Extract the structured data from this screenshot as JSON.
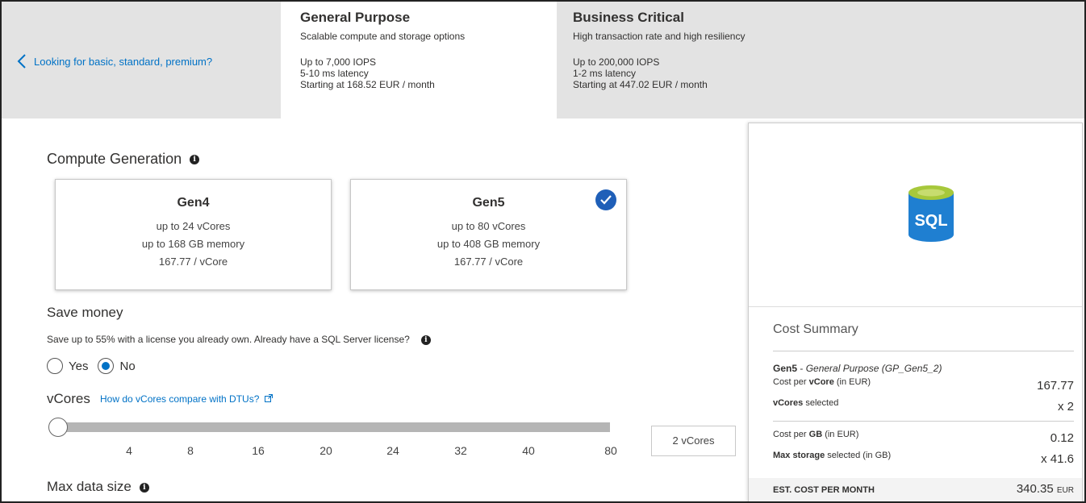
{
  "back_link": {
    "label": "Looking for basic, standard, premium?"
  },
  "tiers": {
    "general": {
      "title": "General Purpose",
      "subtitle": "Scalable compute and storage options",
      "iops": "Up to 7,000 IOPS",
      "latency": "5-10 ms latency",
      "price": "Starting at 168.52 EUR / month"
    },
    "business": {
      "title": "Business Critical",
      "subtitle": "High transaction rate and high resiliency",
      "iops": "Up to 200,000 IOPS",
      "latency": "1-2 ms latency",
      "price": "Starting at 447.02 EUR / month"
    }
  },
  "compute": {
    "title": "Compute Generation",
    "gen4": {
      "name": "Gen4",
      "vcores": "up to 24 vCores",
      "memory": "up to 168 GB memory",
      "price": "167.77 / vCore"
    },
    "gen5": {
      "name": "Gen5",
      "vcores": "up to 80 vCores",
      "memory": "up to 408 GB memory",
      "price": "167.77 / vCore",
      "selected": true
    }
  },
  "save_money": {
    "title": "Save money",
    "text": "Save up to 55% with a license you already own. Already have a SQL Server license?",
    "yes_label": "Yes",
    "no_label": "No",
    "selected": "No"
  },
  "vcores": {
    "label": "vCores",
    "link": "How do vCores compare with DTUs?",
    "ticks": [
      "4",
      "8",
      "16",
      "20",
      "24",
      "32",
      "40",
      "80"
    ],
    "value_box": "2 vCores",
    "slider_value": 2
  },
  "max_data_size": {
    "title": "Max data size"
  },
  "summary": {
    "title": "Cost Summary",
    "tier_name": "Gen5",
    "tier_detail": "General Purpose (GP_Gen5_2)",
    "cost_per_vcore_label_pre": "Cost per ",
    "cost_per_vcore_label_bold": "vCore",
    "cost_per_vcore_label_post": " (in EUR)",
    "cost_per_vcore_value": "167.77",
    "vcores_selected_label_bold": "vCores",
    "vcores_selected_label_post": " selected",
    "vcores_selected_value": "x 2",
    "cost_per_gb_label_pre": "Cost per ",
    "cost_per_gb_label_bold": "GB",
    "cost_per_gb_label_post": " (in EUR)",
    "cost_per_gb_value": "0.12",
    "max_storage_label_bold": "Max storage",
    "max_storage_label_post": " selected (in GB)",
    "max_storage_value": "x 41.6",
    "total_label": "EST. COST PER MONTH",
    "total_value": "340.35",
    "total_currency": "EUR"
  },
  "icons": {
    "back": "chevron-left-icon",
    "check": "checkmark-circle-icon",
    "info": "info-icon",
    "external": "external-link-icon",
    "sql": "sql-database-icon"
  },
  "colors": {
    "accent": "#0072c6",
    "check": "#1f5fb8",
    "sql_blue": "#1f7fd1",
    "sql_lid": "#a7c83b"
  }
}
